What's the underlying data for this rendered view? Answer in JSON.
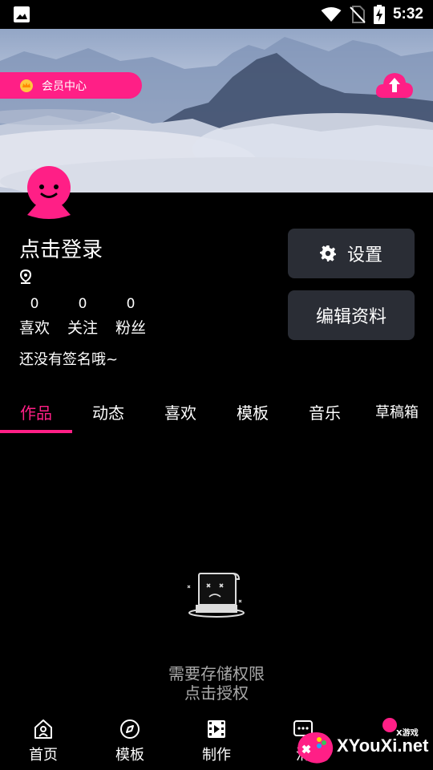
{
  "status_bar": {
    "time": "5:32",
    "icons": [
      "gallery-icon",
      "wifi-icon",
      "no-sim-icon",
      "battery-charging-icon"
    ]
  },
  "banner": {
    "vip_label": "会员中心",
    "upload_icon": "cloud-upload-icon"
  },
  "profile": {
    "login_title": "点击登录",
    "location_icon": "location-pin-icon",
    "stats": [
      {
        "count": "0",
        "label": "喜欢"
      },
      {
        "count": "0",
        "label": "关注"
      },
      {
        "count": "0",
        "label": "粉丝"
      }
    ],
    "signature": "还没有签名哦~"
  },
  "actions": {
    "settings_label": "设置",
    "edit_label": "编辑资料"
  },
  "tabs": [
    {
      "label": "作品",
      "active": true
    },
    {
      "label": "动态"
    },
    {
      "label": "喜欢"
    },
    {
      "label": "模板"
    },
    {
      "label": "音乐"
    },
    {
      "label": "草稿箱"
    }
  ],
  "empty_state": {
    "line1": "需要存储权限",
    "line2": "点击授权"
  },
  "bottom_nav": [
    {
      "label": "首页",
      "icon": "home-icon"
    },
    {
      "label": "模板",
      "icon": "template-icon"
    },
    {
      "label": "制作",
      "icon": "film-icon"
    },
    {
      "label": "消",
      "icon": "message-icon"
    },
    {
      "label": "",
      "icon": "profile-icon"
    }
  ],
  "watermark": {
    "text": "XYouXi.net",
    "small": "X游戏"
  },
  "colors": {
    "accent": "#ff1f86",
    "button_bg": "#2a2d35",
    "background": "#000000"
  }
}
